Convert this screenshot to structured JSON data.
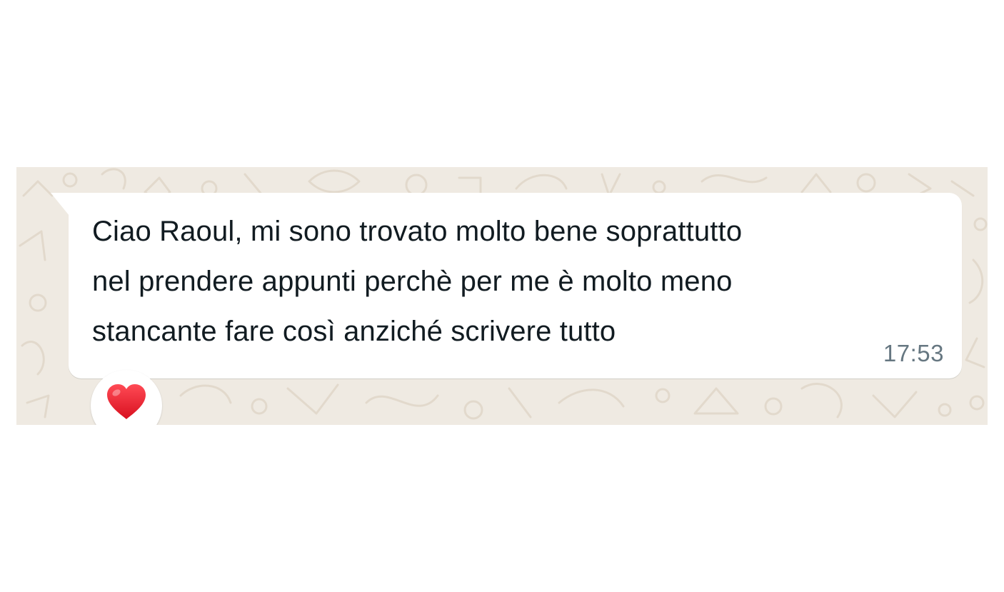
{
  "message": {
    "lines": [
      "Ciao Raoul, mi sono trovato molto bene soprattutto",
      "nel prendere appunti perchè per me è molto meno",
      "stancante fare così anziché scrivere tutto"
    ],
    "time": "17:53"
  },
  "reaction": {
    "emoji": "❤️",
    "icon": "red-heart-icon",
    "color": "#e8202e"
  },
  "colors": {
    "chat_background": "#efeae2",
    "bubble": "#ffffff",
    "text": "#111b21",
    "timestamp": "#667781"
  }
}
